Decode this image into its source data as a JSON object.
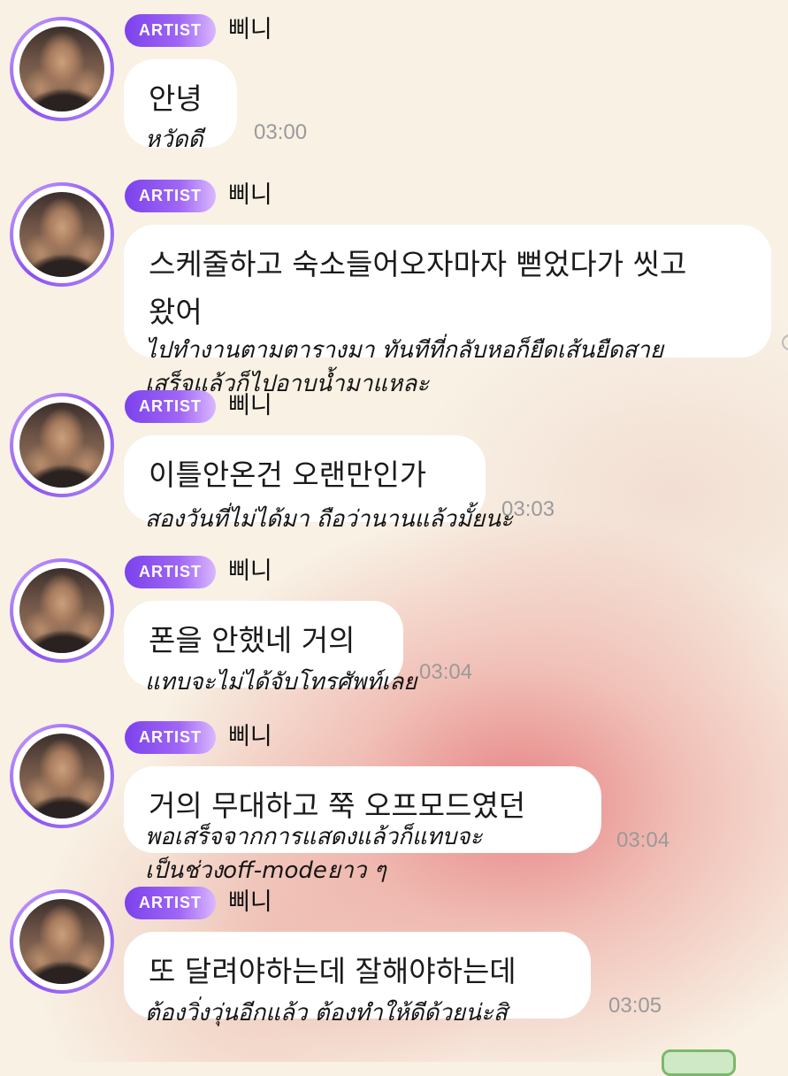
{
  "messages": [
    {
      "badge": "ARTIST",
      "sender": "삐니",
      "text": "안녕",
      "time": "03:00",
      "translation": "หวัดดี"
    },
    {
      "badge": "ARTIST",
      "sender": "삐니",
      "text": "스케줄하고 숙소들어오자마자 뻗었다가 씻고\n왔어",
      "time": "",
      "translation": "ไปทำงานตามตารางมา ทันทีที่กลับหอก็ยืดเส้นยืดสาย\nเสร็จแล้วก็ไปอาบน้ำมาแหละ"
    },
    {
      "badge": "ARTIST",
      "sender": "삐니",
      "text": "이틀안온건 오랜만인가",
      "time": "03:03",
      "translation": "สองวันที่ไม่ได้มา ถือว่านานแล้วมั้ยนะ"
    },
    {
      "badge": "ARTIST",
      "sender": "삐니",
      "text": "폰을 안했네 거의",
      "time": "03:04",
      "translation": "แทบจะไม่ได้จับโทรศัพท์เลย"
    },
    {
      "badge": "ARTIST",
      "sender": "삐니",
      "text": "거의 무대하고  쭉 오프모드였던",
      "time": "03:04",
      "translation": "พอเสร็จจากการแสดงแล้วก็แทบจะ\nเป็นช่วงoff-modeยาว ๆ"
    },
    {
      "badge": "ARTIST",
      "sender": "삐니",
      "text": "또 달려야하는데 잘해야하는데",
      "time": "03:05",
      "translation": "ต้องวิ่งวุ่นอีกแล้ว ต้องทำให้ดีด้วยน่ะสิ"
    }
  ]
}
